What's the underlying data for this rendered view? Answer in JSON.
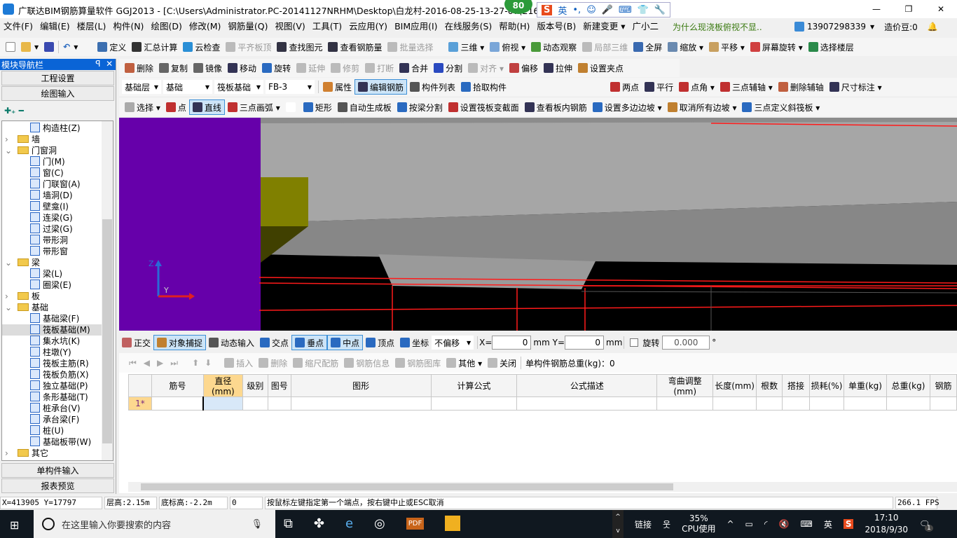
{
  "window": {
    "title": "广联达BIM钢筋算量软件 GGJ2013 - [C:\\Users\\Administrator.PC-20141127NRHM\\Desktop\\白龙村-2016-08-25-13-27-07(216",
    "badge": "80",
    "ime": [
      "英",
      "•,",
      "☺",
      "🎤",
      "⌨",
      "👕",
      "🔧"
    ],
    "controls": [
      "—",
      "❐",
      "✕"
    ]
  },
  "menu": [
    "文件(F)",
    "编辑(E)",
    "楼层(L)",
    "构件(N)",
    "绘图(D)",
    "修改(M)",
    "钢筋量(Q)",
    "视图(V)",
    "工具(T)",
    "云应用(Y)",
    "BIM应用(I)",
    "在线服务(S)",
    "帮助(H)",
    "版本号(B)",
    "新建变更 ▾",
    "广小二"
  ],
  "menu_right": {
    "hint": "为什么现浇板俯视不显..",
    "phone": "13907298339",
    "beans": "造价豆:0"
  },
  "toolbar1": [
    {
      "l": "定义",
      "c": "#3c6fb0"
    },
    {
      "l": "汇总计算",
      "c": "#333"
    },
    {
      "l": "云检查",
      "c": "#2a8fd6"
    },
    {
      "l": "平齐板顶",
      "c": "#bbb",
      "d": 1
    },
    {
      "l": "查找图元",
      "c": "#334"
    },
    {
      "l": "查看钢筋量",
      "c": "#334"
    },
    {
      "l": "批量选择",
      "c": "#bbb",
      "d": 1
    }
  ],
  "toolbar1b": [
    {
      "l": "三维 ▾",
      "c": "#5aa0d8"
    },
    {
      "l": "俯视 ▾",
      "c": "#7aa6d8"
    },
    {
      "l": "动态观察",
      "c": "#4a9a3a"
    },
    {
      "l": "局部三维",
      "c": "#bbb",
      "d": 1
    },
    {
      "l": "全屏",
      "c": "#3a6ab0"
    },
    {
      "l": "缩放 ▾",
      "c": "#6a8ab0"
    },
    {
      "l": "平移 ▾",
      "c": "#c8a060"
    },
    {
      "l": "屏幕旋转 ▾",
      "c": "#d04040"
    },
    {
      "l": "选择楼层",
      "c": "#2a8a4a"
    }
  ],
  "toolbar2": [
    {
      "l": "删除",
      "c": "#c06040"
    },
    {
      "l": "复制",
      "c": "#666"
    },
    {
      "l": "镜像",
      "c": "#666"
    },
    {
      "l": "移动",
      "c": "#335"
    },
    {
      "l": "旋转",
      "c": "#2a6ac0"
    },
    {
      "l": "延伸",
      "c": "#bbb",
      "d": 1
    },
    {
      "l": "修剪",
      "c": "#bbb",
      "d": 1
    },
    {
      "l": "打断",
      "c": "#bbb",
      "d": 1
    },
    {
      "l": "合并",
      "c": "#335"
    },
    {
      "l": "分割",
      "c": "#2a4ac0"
    },
    {
      "l": "对齐 ▾",
      "c": "#bbb",
      "d": 1
    },
    {
      "l": "偏移",
      "c": "#c04040"
    },
    {
      "l": "拉伸",
      "c": "#335"
    },
    {
      "l": "设置夹点",
      "c": "#c08030"
    }
  ],
  "selectors": [
    "基础层",
    "基础",
    "筏板基础",
    "FB-3"
  ],
  "toolbar3": [
    {
      "l": "属性",
      "c": "#d08030"
    },
    {
      "l": "编辑钢筋",
      "c": "#335",
      "a": 1
    },
    {
      "l": "构件列表",
      "c": "#555"
    },
    {
      "l": "拾取构件",
      "c": "#2a6ac0"
    }
  ],
  "toolbar3b": [
    {
      "l": "两点",
      "c": "#c03030"
    },
    {
      "l": "平行",
      "c": "#335"
    },
    {
      "l": "点角 ▾",
      "c": "#c03030"
    },
    {
      "l": "三点辅轴 ▾",
      "c": "#c03030"
    },
    {
      "l": "删除辅轴",
      "c": "#c06040"
    },
    {
      "l": "尺寸标注 ▾",
      "c": "#335"
    }
  ],
  "toolbar4": [
    {
      "l": "选择 ▾",
      "c": "#aaa"
    },
    {
      "l": "点",
      "c": "#c03030"
    },
    {
      "l": "直线",
      "c": "#335",
      "a": 1
    },
    {
      "l": "三点画弧 ▾",
      "c": "#c03030"
    },
    {
      "l": "",
      "c": "#fff"
    },
    {
      "l": "矩形",
      "c": "#2a6ac0"
    },
    {
      "l": "自动生成板",
      "c": "#555"
    },
    {
      "l": "按梁分割",
      "c": "#2a6ac0"
    },
    {
      "l": "设置筏板变截面",
      "c": "#c03030"
    },
    {
      "l": "查看板内钢筋",
      "c": "#335"
    },
    {
      "l": "设置多边边坡 ▾",
      "c": "#2a6ac0"
    },
    {
      "l": "取消所有边坡 ▾",
      "c": "#c08030"
    },
    {
      "l": "三点定义斜筏板 ▾",
      "c": "#2a6ac0"
    }
  ],
  "nav": {
    "title": "模块导航栏",
    "pin": "ꟼ",
    "close": "✕",
    "top_buttons": [
      "工程设置",
      "绘图输入"
    ],
    "bottom_buttons": [
      "单构件输入",
      "报表预览"
    ],
    "tree": [
      {
        "l": "构造柱(Z)",
        "lv": 2
      },
      {
        "l": "墙",
        "lv": 1,
        "f": "›"
      },
      {
        "l": "门窗洞",
        "lv": 1,
        "f": "⌄"
      },
      {
        "l": "门(M)",
        "lv": 2
      },
      {
        "l": "窗(C)",
        "lv": 2
      },
      {
        "l": "门联窗(A)",
        "lv": 2
      },
      {
        "l": "墙洞(D)",
        "lv": 2
      },
      {
        "l": "壁龛(I)",
        "lv": 2
      },
      {
        "l": "连梁(G)",
        "lv": 2
      },
      {
        "l": "过梁(G)",
        "lv": 2
      },
      {
        "l": "带形洞",
        "lv": 2
      },
      {
        "l": "带形窗",
        "lv": 2
      },
      {
        "l": "梁",
        "lv": 1,
        "f": "⌄"
      },
      {
        "l": "梁(L)",
        "lv": 2
      },
      {
        "l": "圈梁(E)",
        "lv": 2
      },
      {
        "l": "板",
        "lv": 1,
        "f": "›"
      },
      {
        "l": "基础",
        "lv": 1,
        "f": "⌄"
      },
      {
        "l": "基础梁(F)",
        "lv": 2
      },
      {
        "l": "筏板基础(M)",
        "lv": 2,
        "s": 1
      },
      {
        "l": "集水坑(K)",
        "lv": 2
      },
      {
        "l": "柱墩(Y)",
        "lv": 2
      },
      {
        "l": "筏板主筋(R)",
        "lv": 2
      },
      {
        "l": "筏板负筋(X)",
        "lv": 2
      },
      {
        "l": "独立基础(P)",
        "lv": 2
      },
      {
        "l": "条形基础(T)",
        "lv": 2
      },
      {
        "l": "桩承台(V)",
        "lv": 2
      },
      {
        "l": "承台梁(F)",
        "lv": 2
      },
      {
        "l": "桩(U)",
        "lv": 2
      },
      {
        "l": "基础板带(W)",
        "lv": 2
      },
      {
        "l": "其它",
        "lv": 1,
        "f": "›"
      }
    ]
  },
  "snapbar": {
    "items": [
      {
        "l": "正交",
        "c": "#c06060"
      },
      {
        "l": "对象捕捉",
        "c": "#c08030",
        "a": 1
      },
      {
        "l": "动态输入",
        "c": "#555"
      },
      {
        "l": "交点",
        "c": "#2a6ac0"
      },
      {
        "l": "垂点",
        "c": "#2a6ac0",
        "a": 1
      },
      {
        "l": "中点",
        "c": "#2a6ac0",
        "a": 1
      },
      {
        "l": "顶点",
        "c": "#2a6ac0"
      },
      {
        "l": "坐标",
        "c": "#2a6ac0"
      }
    ],
    "offset": "不偏移",
    "x_label": "X=",
    "x": "0",
    "y_label": "Y=",
    "y": "0",
    "unit": "mm",
    "rotate_label": "旋转",
    "rotate": "0.000",
    "deg": "°"
  },
  "rebar": {
    "toolbar": [
      {
        "l": "插入",
        "d": 1
      },
      {
        "l": "删除",
        "d": 1
      },
      {
        "l": "缩尺配筋",
        "d": 1
      },
      {
        "l": "钢筋信息",
        "d": 1
      },
      {
        "l": "钢筋图库",
        "d": 1
      },
      {
        "l": "其他 ▾"
      },
      {
        "l": "关闭"
      }
    ],
    "total": "单构件钢筋总重(kg)：0",
    "columns": [
      "筋号",
      "直径(mm)",
      "级别",
      "图号",
      "图形",
      "计算公式",
      "公式描述",
      "弯曲调整(mm)",
      "长度(mm)",
      "根数",
      "搭接",
      "损耗(%)",
      "单重(kg)",
      "总重(kg)",
      "钢筋"
    ],
    "rows": [
      {
        "n": "1*"
      }
    ]
  },
  "status": {
    "coords": "X=413905 Y=17797",
    "floor_height": "层高:2.15m",
    "bottom_elev": "底标高:-2.2m",
    "value": "0",
    "hint": "按鼠标左键指定第一个端点，按右键中止或ESC取消",
    "fps": "266.1 FPS"
  },
  "axis": {
    "z": "Z",
    "y": "Y"
  },
  "taskbar": {
    "search": "在这里输入你要搜索的内容",
    "link": "链接",
    "cpu": "35%",
    "cpu_label": "CPU使用",
    "ime": "英",
    "time": "17:10",
    "date": "2018/9/30",
    "notif": "1"
  },
  "colors": {
    "purple": "#6600aa",
    "olive": "#808000",
    "accent": "#0a64d6"
  }
}
